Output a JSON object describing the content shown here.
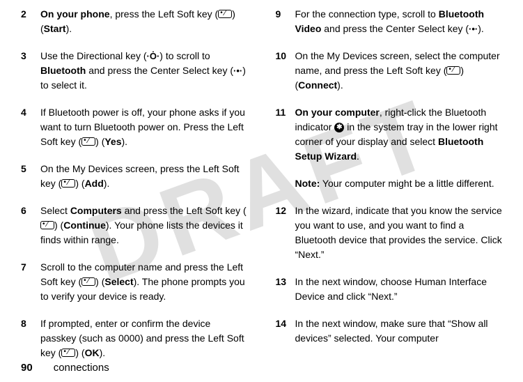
{
  "watermark": "DRAFT",
  "footer": {
    "page": "90",
    "section": "connections"
  },
  "left_column": [
    {
      "num": "2",
      "html": "<span class='bold'>On your phone</span>, press the Left Soft key (<span class='icon-box'></span>) (<span class='condensed'>Start</span>)."
    },
    {
      "num": "3",
      "html": "Use the Directional key (<span class='icon-dir'>·Ȯ·</span>) to scroll to <span class='condensed'>Bluetooth</span> and press the Center Select key (<span class='icon-center'>·•·</span>) to select it."
    },
    {
      "num": "4",
      "html": "If Bluetooth power is off, your phone asks if you want to turn Bluetooth power on. Press the Left Soft key (<span class='icon-box'></span>) (<span class='condensed'>Yes</span>)."
    },
    {
      "num": "5",
      "html": "On the My Devices screen, press the Left Soft key (<span class='icon-box'></span>) (<span class='condensed'>Add</span>)."
    },
    {
      "num": "6",
      "html": "Select <span class='condensed'>Computers</span> and press the Left Soft key (<span class='icon-box'></span>) (<span class='condensed'>Continue</span>). Your phone lists the devices it finds within range."
    },
    {
      "num": "7",
      "html": "Scroll to the computer name and press the Left Soft key (<span class='icon-box'></span>) (<span class='condensed'>Select</span>). The phone prompts you to verify your device is ready."
    },
    {
      "num": "8",
      "html": "If prompted, enter or confirm the device passkey (such as 0000) and press the Left Soft key (<span class='icon-box'></span>) (<span class='condensed'>OK</span>)."
    }
  ],
  "right_column": [
    {
      "num": "9",
      "html": "For the connection type, scroll to <span class='condensed'>Bluetooth Video</span> and press the Center Select key (<span class='icon-center'>·•·</span>)."
    },
    {
      "num": "10",
      "html": "On the My Devices screen, select the computer name, and press the Left Soft key (<span class='icon-box'></span>) (<span class='condensed'>Connect</span>)."
    },
    {
      "num": "11",
      "html": "<span class='bold'>On your computer</span>, right-click the Bluetooth indicator <span class='bt-icon'>✱</span> in the system tray in the lower right corner of your display and select <span class='bold'>Bluetooth Setup Wizard</span>."
    },
    {
      "type": "note",
      "html": "<span class='bold'>Note:</span> Your computer might be a little different."
    },
    {
      "num": "12",
      "html": "In the wizard, indicate that you know the service you want to use, and you want to find a Bluetooth device that provides the service. Click “Next.”"
    },
    {
      "num": "13",
      "html": "In the next window, choose Human Interface Device and click “Next.”"
    },
    {
      "num": "14",
      "html": "In the next window, make sure that “Show all devices” selected. Your computer"
    }
  ]
}
